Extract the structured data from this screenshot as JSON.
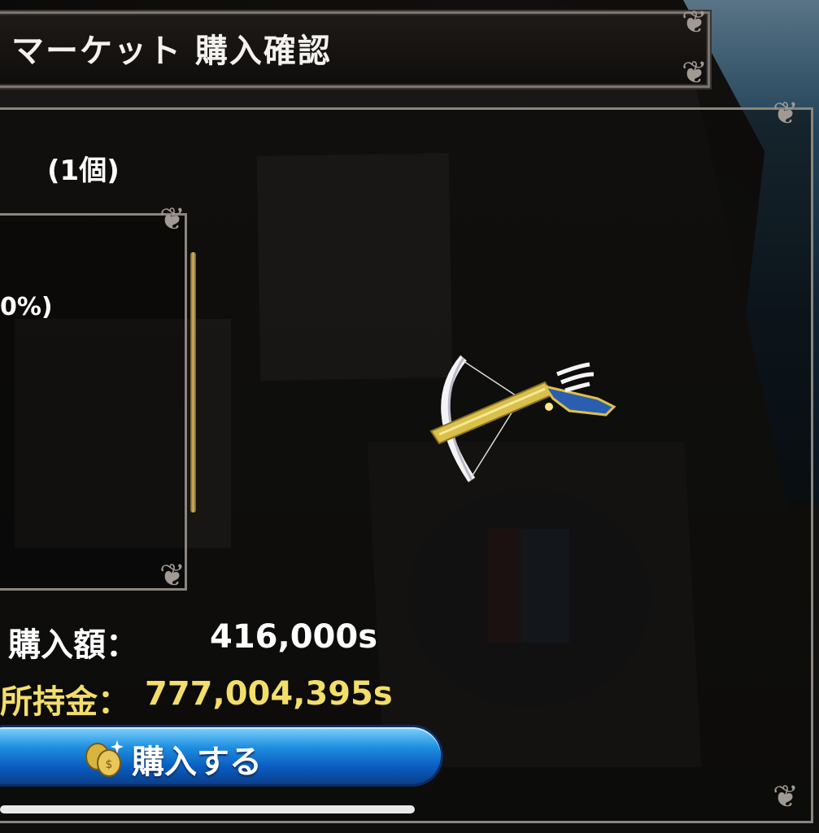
{
  "header": {
    "title": "マーケット 購入確認"
  },
  "detail": {
    "quantity": "(1個)",
    "rate_fragment": "0%)"
  },
  "purchase": {
    "price_label": "購入額：",
    "price_value": "416,000s",
    "money_label": "所持金：",
    "money_value": "777,004,395s"
  },
  "buy_button": {
    "label": "購入する",
    "icon": "coins-icon"
  },
  "item": {
    "icon": "crossbow-icon"
  },
  "colors": {
    "gold_text": "#f3de6a",
    "button_blue": "#1f8fe0"
  }
}
